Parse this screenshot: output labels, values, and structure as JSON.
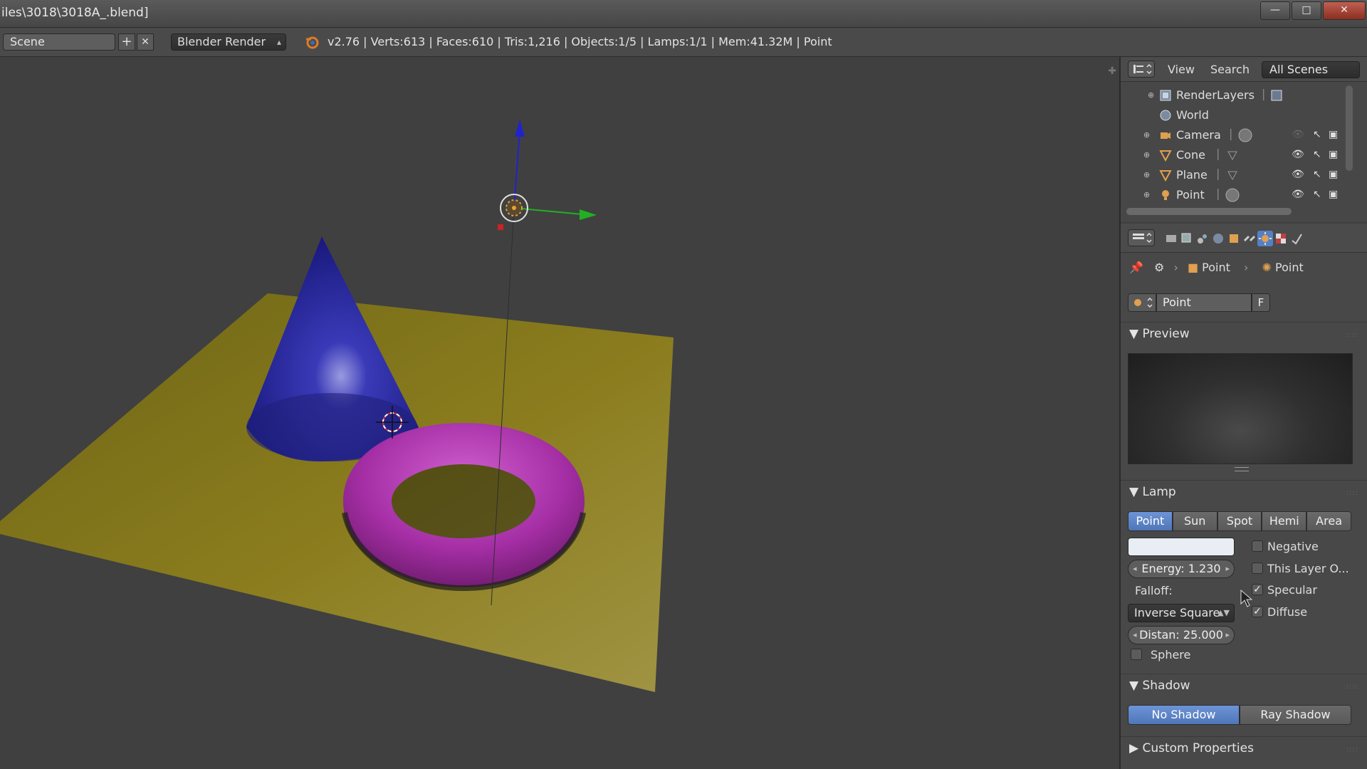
{
  "window": {
    "title": "iles\\3018\\3018A_.blend]",
    "minimize": "—",
    "maximize": "□",
    "close": "✕"
  },
  "infobar": {
    "scene_name": "Scene",
    "add_scene": "+",
    "remove_scene": "✕",
    "render_engine": "Blender Render",
    "stats": "v2.76 | Verts:613 | Faces:610 | Tris:1,216 | Objects:1/5 | Lamps:1/1 | Mem:41.32M | Point"
  },
  "outliner": {
    "menu_view": "View",
    "menu_search": "Search",
    "display_mode": "All Scenes",
    "items": [
      {
        "label": "RenderLayers",
        "icon": "renderlayers-icon"
      },
      {
        "label": "World",
        "icon": "world-icon"
      },
      {
        "label": "Camera",
        "icon": "camera-icon"
      },
      {
        "label": "Cone",
        "icon": "mesh-icon"
      },
      {
        "label": "Plane",
        "icon": "mesh-icon"
      },
      {
        "label": "Point",
        "icon": "lamp-icon"
      }
    ]
  },
  "properties": {
    "breadcrumb_object": "Point",
    "breadcrumb_data": "Point",
    "datablock_name": "Point",
    "datablock_fake_user": "F",
    "preview_title": "Preview",
    "lamp_title": "Lamp",
    "lamp_types": [
      "Point",
      "Sun",
      "Spot",
      "Hemi",
      "Area"
    ],
    "lamp_type_selected": "Point",
    "lamp_color": "#e8eef3",
    "energy_label": "Energy:  1.230",
    "falloff_label": "Falloff:",
    "falloff_value": "Inverse Square",
    "distance_label": "Distan: 25.000",
    "sphere_label": "Sphere",
    "negative_label": "Negative",
    "this_layer_label": "This Layer O...",
    "specular_label": "Specular",
    "diffuse_label": "Diffuse",
    "negative_checked": false,
    "this_layer_checked": false,
    "specular_checked": true,
    "diffuse_checked": true,
    "sphere_checked": false,
    "shadow_title": "Shadow",
    "shadow_no": "No Shadow",
    "shadow_ray": "Ray Shadow",
    "custom_props_title": "Custom Properties"
  },
  "colors": {
    "accent_blue": "#5680c2",
    "viewport_bg": "#404040",
    "plane": "#8a7a1e",
    "cone": "#2a2aa0",
    "torus": "#a62aa6"
  }
}
